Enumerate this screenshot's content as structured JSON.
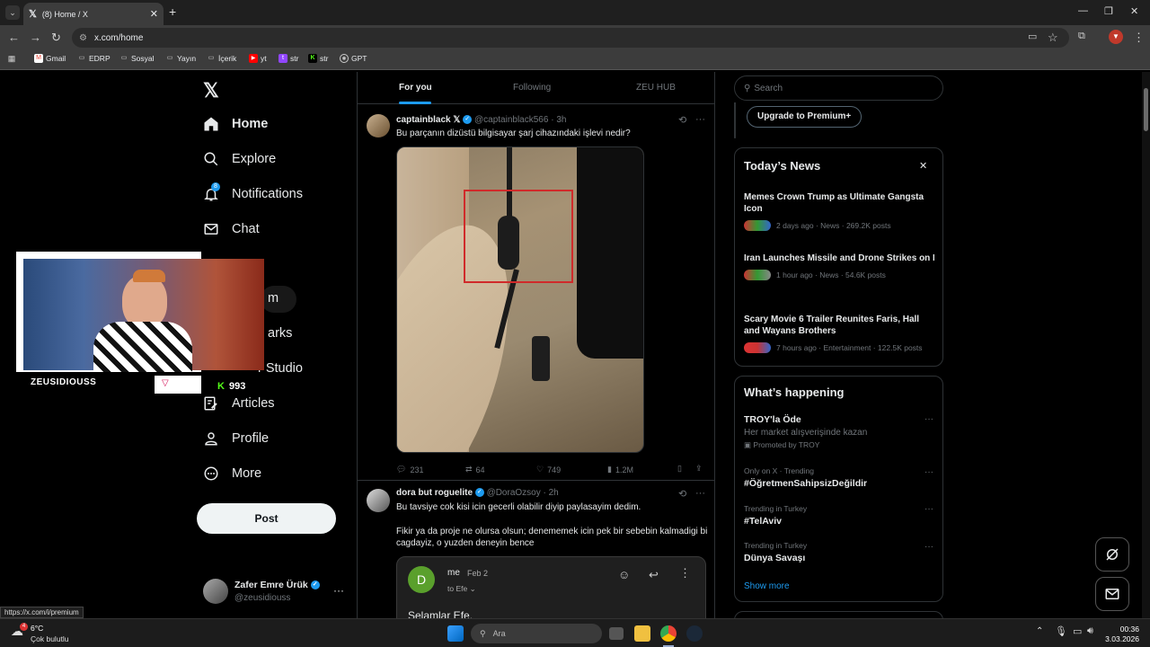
{
  "browser": {
    "tab_title": "(8) Home / X",
    "url": "x.com/home",
    "status_url": "https://x.com/i/premium",
    "bookmarks": [
      "Gmail",
      "EDRP",
      "Sosyal",
      "Yayın",
      "İçerik",
      "yt",
      "str",
      "str",
      "GPT"
    ]
  },
  "nav": {
    "home": "Home",
    "explore": "Explore",
    "notifications": "Notifications",
    "notif_badge": "8",
    "chat": "Chat",
    "premium_partial": "m",
    "bookmarks_partial": "arks",
    "studio_partial": "r Studio",
    "articles": "Articles",
    "profile": "Profile",
    "more": "More",
    "post": "Post",
    "user_name": "Zafer Emre Ürük",
    "user_handle": "@zeusidiouss"
  },
  "overlay": {
    "streamer": "ZEUSIDIOUSS",
    "kick_count": "993"
  },
  "feed": {
    "tabs": [
      "For you",
      "Following",
      "ZEU HUB"
    ],
    "tweet1": {
      "name": "captainblack",
      "badge": "𝕏",
      "handle": "@captainblack566 · 3h",
      "text": "Bu parçanın dizüstü bilgisayar şarj cihazındaki işlevi nedir?",
      "replies": "231",
      "retweets": "64",
      "likes": "749",
      "views": "1.2M"
    },
    "tweet2": {
      "name": "dora but roguelite",
      "handle": "@DoraOzsoy · 2h",
      "text1": "Bu tavsiye cok kisi icin gecerli olabilir diyip paylasayim dedim.",
      "text2": "Fikir ya da proje ne olursa olsun; denememek icin pek bir sebebin kalmadigi bi cagdayiz, o yuzden deneyin bence",
      "email_sender": "me",
      "email_date": "Feb 2",
      "email_to": "to Efe",
      "email_initial": "D",
      "email_body": "Selamlar Efe,"
    }
  },
  "right": {
    "search_placeholder": "Search",
    "upgrade": "Upgrade to Premium+",
    "news_title": "Today’s News",
    "news": [
      {
        "title": "Memes Crown Trump as Ultimate Gangsta Icon",
        "meta": "2 days ago · News · 269.2K posts"
      },
      {
        "title": "Iran Launches Missile and Drone Strikes on Israel, U.S. Bases, and Gulf States Includi...",
        "meta": "1 hour ago · News · 54.6K posts"
      },
      {
        "title": "Scary Movie 6 Trailer Reunites Faris, Hall and Wayans Brothers",
        "meta": "7 hours ago · Entertainment · 122.5K posts"
      }
    ],
    "happening_title": "What’s happening",
    "trends": [
      {
        "meta": "",
        "title": "TROY'la Öde",
        "sub": "Her market alışverişinde kazan",
        "promo": "Promoted by TROY"
      },
      {
        "meta": "Only on X · Trending",
        "title": "#ÖğretmenSahipsizDeğildir"
      },
      {
        "meta": "Trending in Turkey",
        "title": "#TelAviv"
      },
      {
        "meta": "Trending in Turkey",
        "title": "Dünya Savaşı"
      }
    ],
    "show_more": "Show more"
  },
  "taskbar": {
    "temp": "6°C",
    "weather": "Çok bulutlu",
    "weather_badge": "4",
    "search": "Ara",
    "time": "00:36",
    "date": "3.03.2026"
  }
}
